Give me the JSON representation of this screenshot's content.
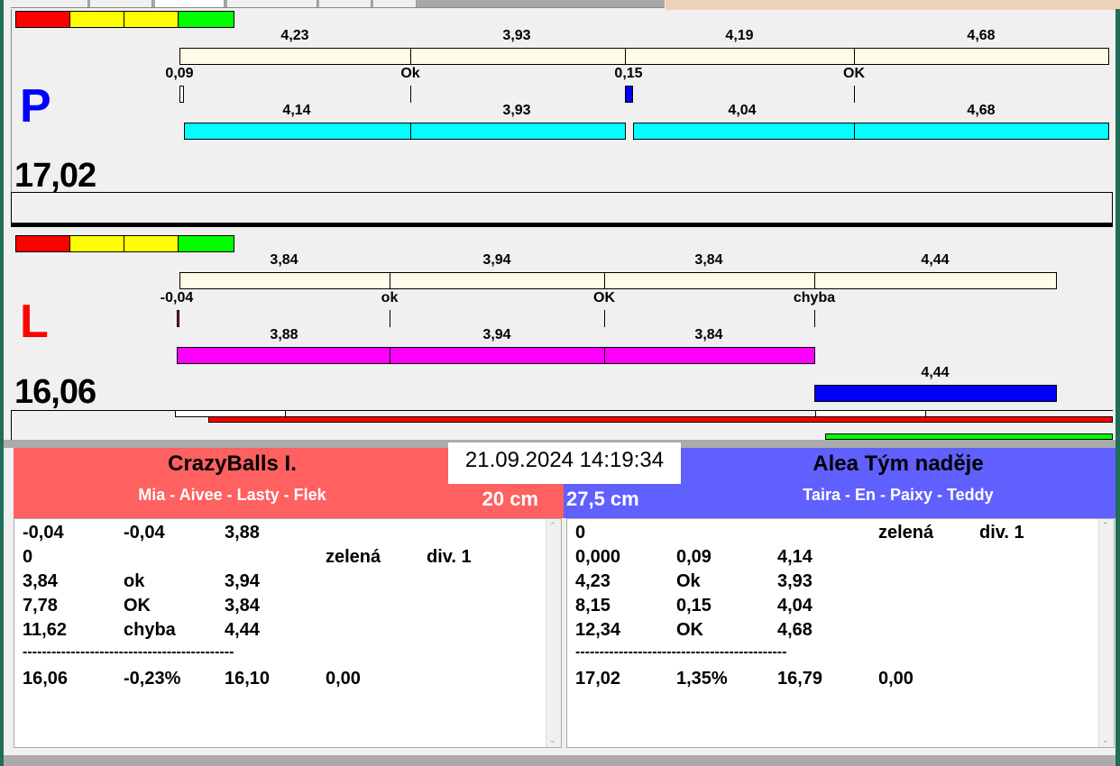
{
  "colors": {
    "red": "#ff0000",
    "yellow": "#ffff00",
    "green": "#00ff00",
    "cream": "#fffde8",
    "cyan": "#00ffff",
    "magenta": "#ff00ff",
    "blue": "#0000ff",
    "team_red": "#ff6060",
    "team_blue": "#6060ff"
  },
  "P": {
    "letter": "P",
    "total": "17,02",
    "top_labels": [
      "4,23",
      "3,93",
      "4,19",
      "4,68"
    ],
    "mid_labels": [
      "0,09",
      "Ok",
      "0,15",
      "OK"
    ],
    "lower_labels": [
      "4,14",
      "3,93",
      "4,04",
      "4,68"
    ]
  },
  "L": {
    "letter": "L",
    "total": "16,06",
    "top_labels": [
      "3,84",
      "3,94",
      "3,84",
      "4,44"
    ],
    "mid_labels": [
      "-0,04",
      "ok",
      "OK",
      "chyba"
    ],
    "lower_labels": [
      "3,88",
      "3,94",
      "3,84"
    ],
    "extra_label": "4,44"
  },
  "datetime": "21.09.2024 14:19:34",
  "left_team": {
    "name": "CrazyBalls I.",
    "members": "Mia - Aivee - Lasty - Flek",
    "distance": "20 cm",
    "rows": [
      [
        "-0,04",
        "-0,04",
        "3,88",
        "",
        ""
      ],
      [
        "0",
        "",
        "",
        "zelená",
        "div. 1"
      ],
      [
        "3,84",
        "ok",
        "3,94",
        "",
        ""
      ],
      [
        "7,78",
        "OK",
        "3,84",
        "",
        ""
      ],
      [
        "11,62",
        "chyba",
        "4,44",
        "",
        ""
      ]
    ],
    "separator": "--------------------------------------------",
    "summary": [
      "16,06",
      "-0,23%",
      "16,10",
      "0,00"
    ]
  },
  "right_team": {
    "name": "Alea Tým naděje",
    "members": "Taira - En - Paixy - Teddy",
    "distance": "27,5 cm",
    "rows": [
      [
        "0",
        "",
        "",
        "zelená",
        "div. 1"
      ],
      [
        "0,000",
        "0,09",
        "4,14",
        "",
        ""
      ],
      [
        "4,23",
        "Ok",
        "3,93",
        "",
        ""
      ],
      [
        "8,15",
        "0,15",
        "4,04",
        "",
        ""
      ],
      [
        "12,34",
        "OK",
        "4,68",
        "",
        ""
      ]
    ],
    "separator": "--------------------------------------------",
    "summary": [
      "17,02",
      "1,35%",
      "16,79",
      "0,00"
    ]
  }
}
